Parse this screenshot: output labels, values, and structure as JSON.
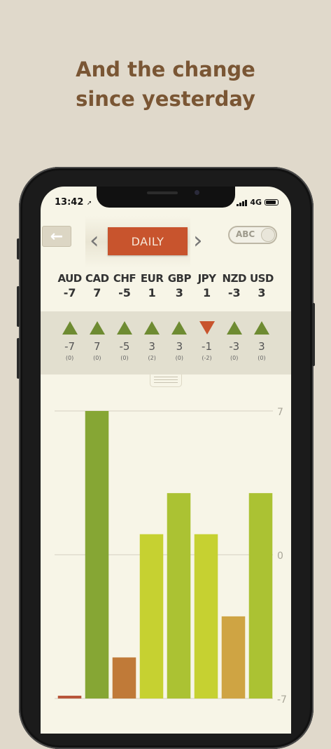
{
  "headline": {
    "line1": "And the change",
    "line2": "since yesterday"
  },
  "status_bar": {
    "time": "13:42",
    "network": "4G"
  },
  "nav": {
    "back_icon": "←",
    "period": "DAILY",
    "prev_icon": "‹",
    "next_icon": "›",
    "toggle_label": "ABC"
  },
  "currencies": [
    {
      "code": "AUD",
      "value": "-7",
      "change": "-7",
      "prev": "(0)",
      "dir": "up"
    },
    {
      "code": "CAD",
      "value": "7",
      "change": "7",
      "prev": "(0)",
      "dir": "up"
    },
    {
      "code": "CHF",
      "value": "-5",
      "change": "-5",
      "prev": "(0)",
      "dir": "up"
    },
    {
      "code": "EUR",
      "value": "1",
      "change": "3",
      "prev": "(2)",
      "dir": "up"
    },
    {
      "code": "GBP",
      "value": "3",
      "change": "3",
      "prev": "(0)",
      "dir": "up"
    },
    {
      "code": "JPY",
      "value": "1",
      "change": "-1",
      "prev": "(-2)",
      "dir": "down"
    },
    {
      "code": "NZD",
      "value": "-3",
      "change": "-3",
      "prev": "(0)",
      "dir": "up"
    },
    {
      "code": "USD",
      "value": "3",
      "change": "3",
      "prev": "(0)",
      "dir": "up"
    }
  ],
  "colors": {
    "up": "#6e8b32",
    "down": "#c8542d",
    "accent": "#c8542d"
  },
  "chart_data": {
    "type": "bar",
    "categories": [
      "AUD",
      "CAD",
      "CHF",
      "EUR",
      "GBP",
      "JPY",
      "NZD",
      "USD"
    ],
    "values": [
      -7,
      7,
      -5,
      1,
      3,
      1,
      -3,
      3
    ],
    "colors": [
      "#b8553a",
      "#86a634",
      "#c07a38",
      "#c6d131",
      "#abc233",
      "#c6d131",
      "#cfa443",
      "#abc233"
    ],
    "ylim": [
      -7,
      7
    ],
    "yticks": [
      "7",
      "0",
      "-7"
    ],
    "grid": true
  }
}
